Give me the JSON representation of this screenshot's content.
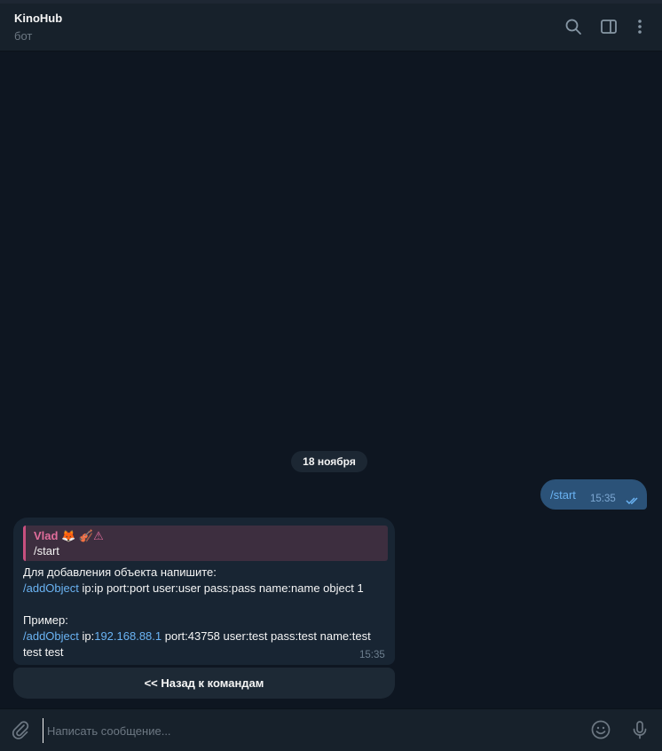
{
  "header": {
    "title": "KinoHub",
    "subtitle": "бот",
    "icons": [
      "search-icon",
      "sidebar-toggle-icon",
      "more-vertical-icon"
    ]
  },
  "chat": {
    "date_separator": "18 ноября",
    "outgoing": {
      "text": "/start",
      "time": "15:35",
      "status": "double-check-read"
    },
    "incoming": {
      "reply": {
        "author": "Vlad",
        "author_emoji": "🦊 🎻⚠",
        "text": "/start"
      },
      "lines": [
        {
          "segments": [
            {
              "text": "Для добавления объекта напишите:",
              "type": "text"
            }
          ]
        },
        {
          "segments": [
            {
              "text": "/addObject",
              "type": "command"
            },
            {
              "text": " ip:ip port:port user:user pass:pass name:name object 1",
              "type": "text"
            }
          ]
        },
        {
          "segments": []
        },
        {
          "segments": [
            {
              "text": "Пример:",
              "type": "text"
            }
          ]
        },
        {
          "segments": [
            {
              "text": "/addObject",
              "type": "command"
            },
            {
              "text": " ip:",
              "type": "text"
            },
            {
              "text": "192.168.88.1",
              "type": "command"
            },
            {
              "text": " port:43758 user:test pass:test name:test",
              "type": "text"
            }
          ]
        },
        {
          "segments": [
            {
              "text": "test test",
              "type": "text"
            }
          ]
        }
      ],
      "time": "15:35"
    },
    "inline_button": "<< Назад к командам"
  },
  "composer": {
    "placeholder": "Написать сообщение...",
    "value": "",
    "icons": [
      "paperclip-icon",
      "emoji-icon",
      "microphone-icon"
    ]
  },
  "colors": {
    "background": "#0e1621",
    "panel": "#17212b",
    "outgoing_bubble": "#2b5278",
    "incoming_bubble": "#182533",
    "link": "#6ab3f3",
    "reply_accent": "#e16d9b"
  }
}
